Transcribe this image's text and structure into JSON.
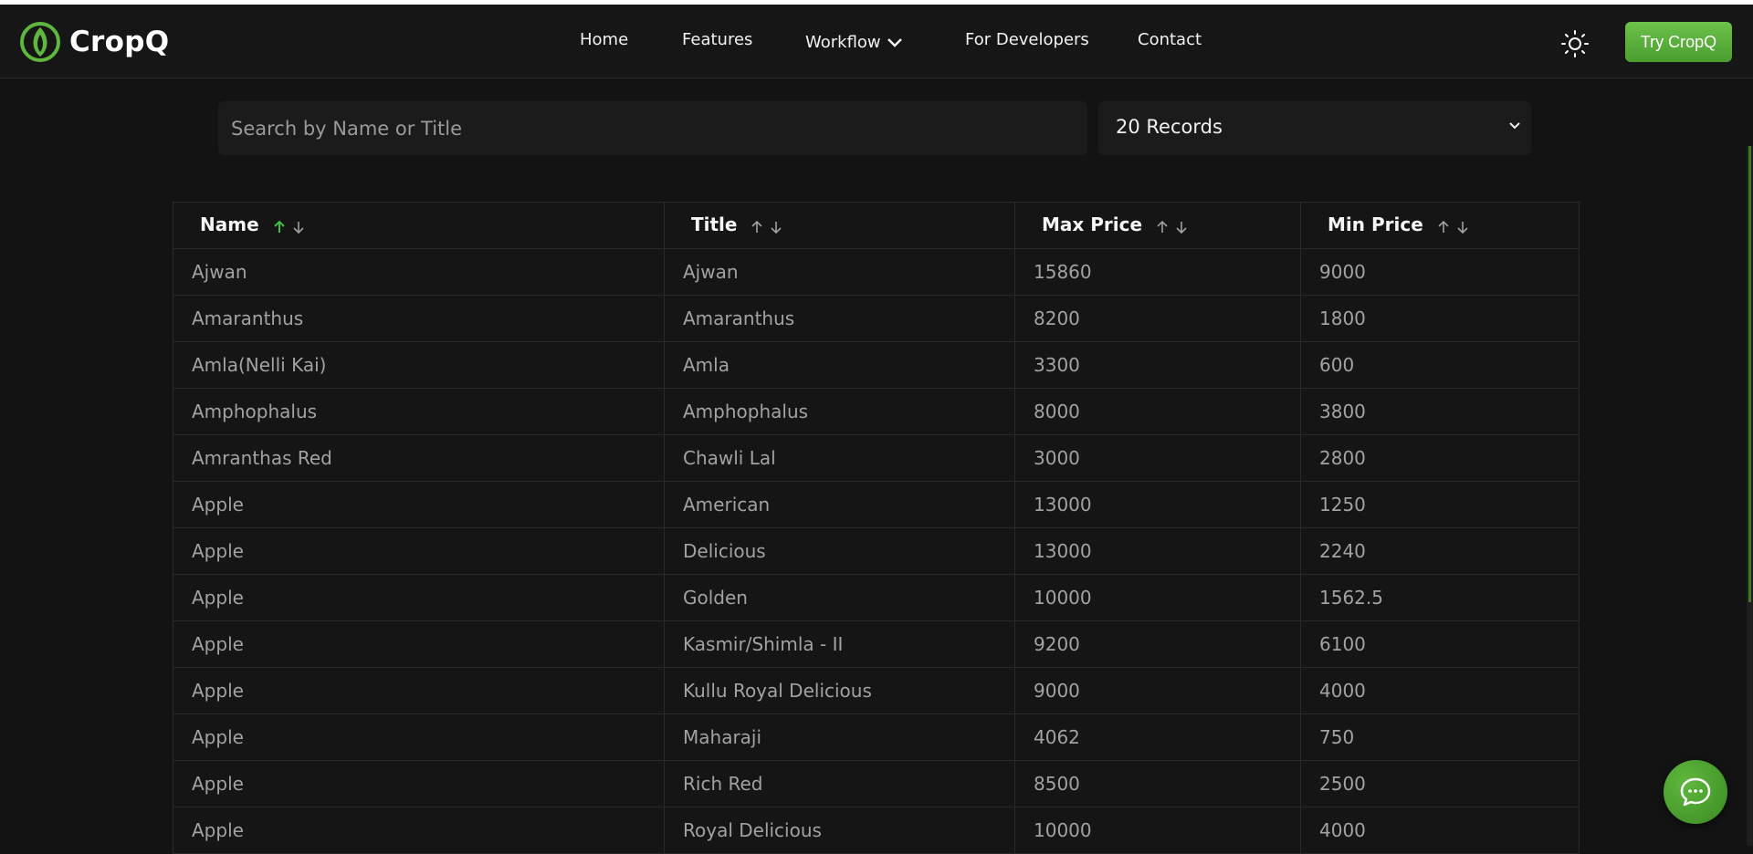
{
  "brand": {
    "name": "CropQ",
    "accent_color": "#5db83d"
  },
  "nav": {
    "items": [
      {
        "label": "Home"
      },
      {
        "label": "Features"
      },
      {
        "label": "Workflow"
      },
      {
        "label": "For Developers"
      },
      {
        "label": "Contact"
      }
    ],
    "cta_label": "Try CropQ",
    "theme_icon": "sun-icon"
  },
  "filters": {
    "search_placeholder": "Search by Name or Title",
    "records_value": "20 Records"
  },
  "table": {
    "columns": [
      "Name",
      "Title",
      "Max Price",
      "Min Price"
    ],
    "active_sort": {
      "column": "Name",
      "direction": "asc"
    },
    "rows": [
      [
        "Ajwan",
        "Ajwan",
        "15860",
        "9000"
      ],
      [
        "Amaranthus",
        "Amaranthus",
        "8200",
        "1800"
      ],
      [
        "Amla(Nelli Kai)",
        "Amla",
        "3300",
        "600"
      ],
      [
        "Amphophalus",
        "Amphophalus",
        "8000",
        "3800"
      ],
      [
        "Amranthas Red",
        "Chawli Lal",
        "3000",
        "2800"
      ],
      [
        "Apple",
        "American",
        "13000",
        "1250"
      ],
      [
        "Apple",
        "Delicious",
        "13000",
        "2240"
      ],
      [
        "Apple",
        "Golden",
        "10000",
        "1562.5"
      ],
      [
        "Apple",
        "Kasmir/Shimla - II",
        "9200",
        "6100"
      ],
      [
        "Apple",
        "Kullu Royal Delicious",
        "9000",
        "4000"
      ],
      [
        "Apple",
        "Maharaji",
        "4062",
        "750"
      ],
      [
        "Apple",
        "Rich Red",
        "8500",
        "2500"
      ],
      [
        "Apple",
        "Royal Delicious",
        "10000",
        "4000"
      ]
    ]
  },
  "chat": {
    "icon": "chat-bubble-icon"
  }
}
